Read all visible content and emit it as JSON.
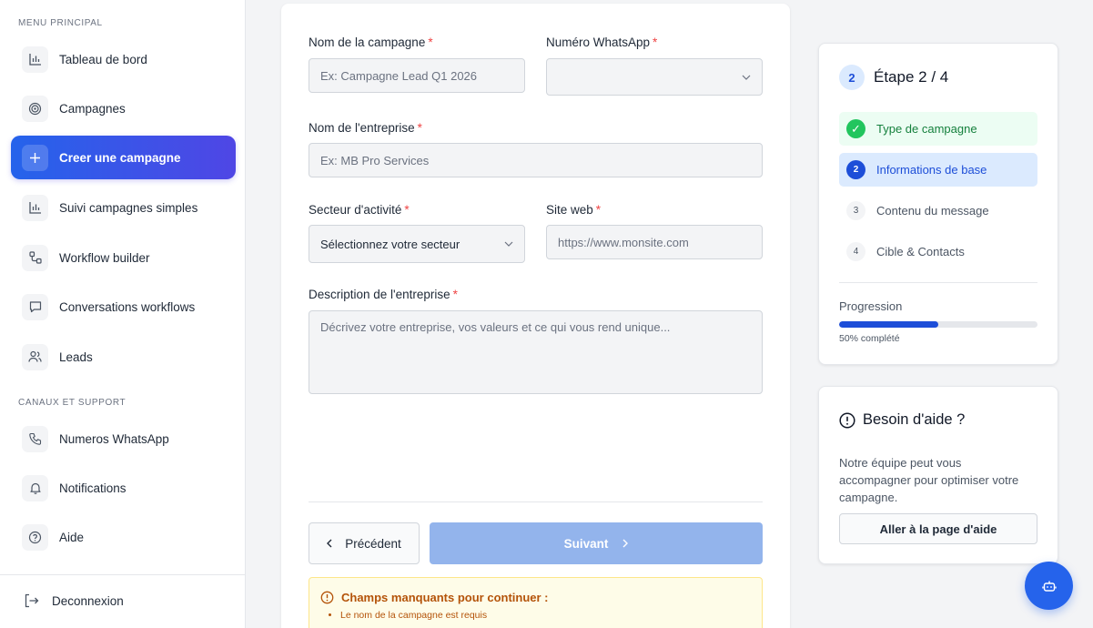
{
  "sidebar": {
    "section_main": "MENU PRINCIPAL",
    "section_support": "CANAUX ET SUPPORT",
    "items": [
      {
        "label": "Tableau de bord",
        "icon": "bar-chart-icon"
      },
      {
        "label": "Campagnes",
        "icon": "target-icon"
      },
      {
        "label": "Creer une campagne",
        "icon": "plus-icon",
        "active": true
      },
      {
        "label": "Suivi campagnes simples",
        "icon": "bar-chart-icon"
      },
      {
        "label": "Workflow builder",
        "icon": "workflow-icon"
      },
      {
        "label": "Conversations workflows",
        "icon": "message-icon"
      },
      {
        "label": "Leads",
        "icon": "users-icon"
      }
    ],
    "support_items": [
      {
        "label": "Numeros WhatsApp",
        "icon": "phone-icon"
      },
      {
        "label": "Notifications",
        "icon": "bell-icon"
      },
      {
        "label": "Aide",
        "icon": "help-circle-icon"
      }
    ],
    "logout_label": "Deconnexion"
  },
  "form": {
    "campaign_name_label": "Nom de la campagne",
    "campaign_name_placeholder": "Ex: Campagne Lead Q1 2026",
    "whatsapp_label": "Numéro WhatsApp",
    "whatsapp_value": "",
    "company_label": "Nom de l'entreprise",
    "company_placeholder": "Ex: MB Pro Services",
    "sector_label": "Secteur d'activité",
    "sector_value": "Sélectionnez votre secteur",
    "website_label": "Site web",
    "website_placeholder": "https://www.monsite.com",
    "description_label": "Description de l'entreprise",
    "description_placeholder": "Décrivez votre entreprise, vos valeurs et ce qui vous rend unique...",
    "required_mark": "*",
    "prev_label": "Précédent",
    "next_label": "Suivant"
  },
  "warning": {
    "title": "Champs manquants pour continuer :",
    "items": [
      "Le nom de la campagne est requis",
      ""
    ]
  },
  "steps": {
    "current_num": "2",
    "title": "Étape 2 / 4",
    "items": [
      {
        "num": "✓",
        "label": "Type de campagne",
        "state": "done"
      },
      {
        "num": "2",
        "label": "Informations de base",
        "state": "current"
      },
      {
        "num": "3",
        "label": "Contenu du message",
        "state": "pending"
      },
      {
        "num": "4",
        "label": "Cible & Contacts",
        "state": "pending"
      }
    ],
    "progress_label": "Progression",
    "progress_fraction": 0.5,
    "progress_text": "50% complété"
  },
  "help": {
    "title": "Besoin d'aide ?",
    "text": "Notre équipe peut vous accompagner pour optimiser votre campagne.",
    "button": "Aller à la page d'aide"
  },
  "colors": {
    "accent": "#2563eb",
    "accent_end": "#4f46e5",
    "success": "#22c55e",
    "warning": "#b45309",
    "required": "#ef4444"
  }
}
